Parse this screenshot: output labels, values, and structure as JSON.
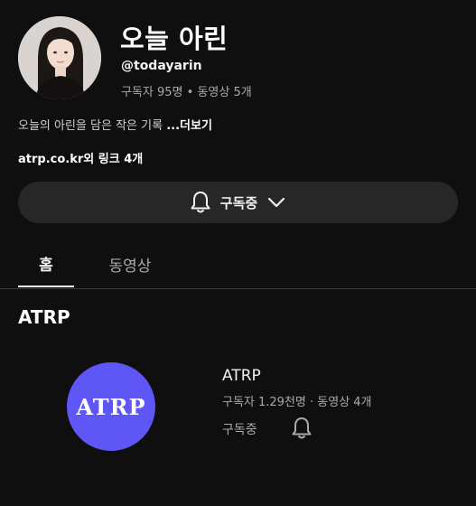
{
  "channel": {
    "name": "오늘 아린",
    "handle": "@todayarin",
    "stats": "구독자 95명 • 동영상 5개",
    "description": "오늘의 아린을 담은 작은 기록",
    "more_label": "...더보기",
    "links": "atrp.co.kr외 링크 4개"
  },
  "subscribe_button": {
    "label": "구독중",
    "bell_icon": "bell-icon",
    "chevron_icon": "chevron-down-icon"
  },
  "tabs": [
    {
      "label": "홈",
      "selected": true
    },
    {
      "label": "동영상",
      "selected": false
    }
  ],
  "section": {
    "title": "ATRP",
    "featured_channel": {
      "logo_text": "ATRP",
      "name": "ATRP",
      "stats": "구독자 1.29천명 · 동영상 4개",
      "subscribe_label": "구독중",
      "bell_icon": "bell-icon"
    }
  },
  "colors": {
    "background": "#0f0f0f",
    "button_bg": "#272727",
    "logo_bg": "#5e57f5"
  }
}
